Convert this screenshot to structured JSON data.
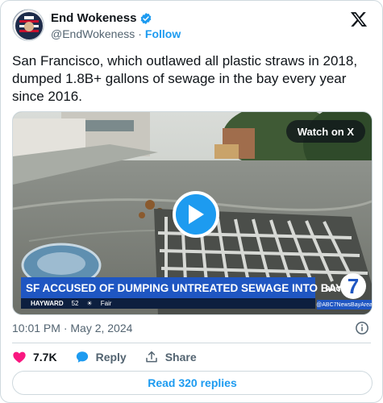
{
  "author": {
    "display_name": "End Wokeness",
    "handle": "@EndWokeness",
    "separator": "·",
    "follow_label": "Follow",
    "avatar_text": "END WOKENESS"
  },
  "tweet": {
    "text": "San Francisco, which outlawed all plastic straws in 2018, dumped 1.8B+ gallons of sewage in the bay every year since 2016.",
    "timestamp": "10:01 PM · May 2, 2024"
  },
  "media": {
    "watch_label": "Watch on X",
    "headline": "SF ACCUSED OF DUMPING UNTREATED SEWAGE INTO BAY",
    "ticker_place": "HAYWARD",
    "ticker_temp": "52",
    "ticker_weather": "Fair",
    "station_logo": "abc 7",
    "station_handle": "@ABC7NewsBayArea"
  },
  "actions": {
    "like_count": "7.7K",
    "reply_label": "Reply",
    "share_label": "Share"
  },
  "read_replies_label": "Read 320 replies",
  "colors": {
    "accent": "#1d9bf0",
    "like": "#f91880",
    "text_secondary": "#536471",
    "border": "#cfd9de"
  },
  "icons": [
    "verified-badge-icon",
    "x-logo-icon",
    "play-icon",
    "info-icon",
    "heart-icon",
    "reply-icon",
    "share-icon"
  ]
}
